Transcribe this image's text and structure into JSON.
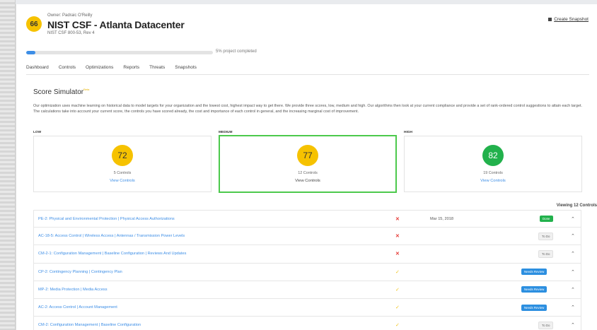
{
  "header": {
    "score": "66",
    "owner": "Owner: Padraic O'Reilly",
    "title": "NIST CSF - Atlanta Datacenter",
    "subtitle": "NIST CSF 800-53, Rev 4",
    "snapshot_label": "Create Snapshot"
  },
  "progress": {
    "percent": 5,
    "label": "5% project completed"
  },
  "tabs": [
    "Dashboard",
    "Controls",
    "Optimizations",
    "Reports",
    "Threats",
    "Snapshots"
  ],
  "simulator": {
    "title": "Score Simulator",
    "beta": "Beta",
    "description": "Our optimization uses machine learning on historical data to model targets for your organization and the lowest cost, highest impact way to get there. We provide three scores, low, medium and high. Our algorithms then look at your current compliance and provide a set of rank-ordered control suggestions to attain each target. The calculations take into account your current score, the controls you have scored already, the cost and importance of each control in general, and the increasing marginal cost of improvement.",
    "tiers": [
      {
        "label": "LOW",
        "score": "72",
        "controls": "5 Controls",
        "view": "View Controls",
        "color": "#f6c200"
      },
      {
        "label": "MEDIUM",
        "score": "77",
        "controls": "12 Controls",
        "view": "View Controls",
        "color": "#f6c200"
      },
      {
        "label": "HIGH",
        "score": "82",
        "controls": "19 Controls",
        "view": "View Controls",
        "color": "#22b14c"
      }
    ]
  },
  "controls": {
    "viewing": "Viewing 12 Controls",
    "rows": [
      {
        "name": "PE-2: Physical and Environmental Protection | Physical Access Authorizations",
        "mark": "✕",
        "date": "Mar 15, 2018",
        "status": "Done"
      },
      {
        "name": "AC-18-5: Access Control | Wireless Access | Antennas / Transmission Power Levels",
        "mark": "✕",
        "date": "",
        "status": "To Do"
      },
      {
        "name": "CM-2-1: Configuration Management | Baseline Configuration | Reviews And Updates",
        "mark": "✕",
        "date": "",
        "status": "To Do"
      },
      {
        "name": "CP-2: Contingency Planning | Contingency Plan",
        "mark": "✓",
        "date": "",
        "status": "Needs Review"
      },
      {
        "name": "MP-2: Media Protection | Media Access",
        "mark": "✓",
        "date": "",
        "status": "Needs Review"
      },
      {
        "name": "AC-2: Access Control | Account Management",
        "mark": "✓",
        "date": "",
        "status": "Needs Review"
      },
      {
        "name": "CM-2: Configuration Management | Baseline Configuration",
        "mark": "✓",
        "date": "",
        "status": "To Do"
      }
    ]
  }
}
